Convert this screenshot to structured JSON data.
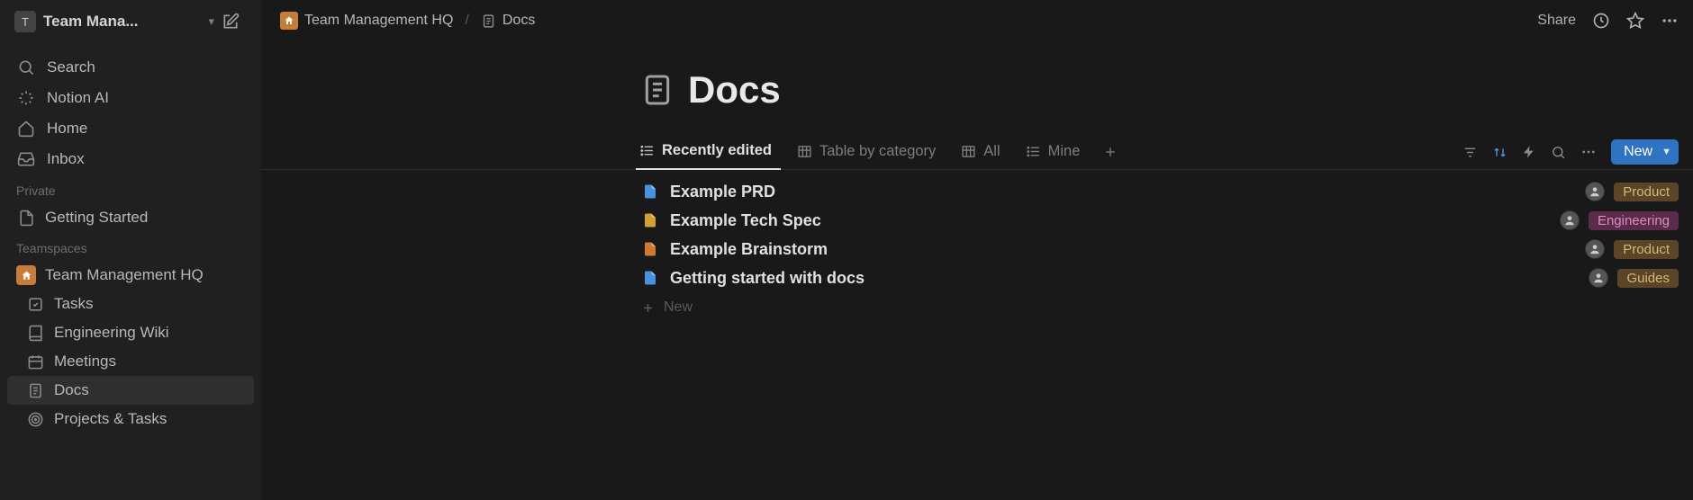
{
  "sidebar": {
    "workspace_letter": "T",
    "workspace_name": "Team Mana...",
    "nav": [
      {
        "icon": "search",
        "label": "Search"
      },
      {
        "icon": "sparkle",
        "label": "Notion AI"
      },
      {
        "icon": "home",
        "label": "Home"
      },
      {
        "icon": "inbox",
        "label": "Inbox"
      }
    ],
    "private_label": "Private",
    "private_pages": [
      {
        "icon": "page",
        "label": "Getting Started"
      }
    ],
    "teamspaces_label": "Teamspaces",
    "teamspace_name": "Team Management HQ",
    "teamspace_pages": [
      {
        "icon": "check",
        "label": "Tasks"
      },
      {
        "icon": "book",
        "label": "Engineering Wiki"
      },
      {
        "icon": "calendar",
        "label": "Meetings"
      },
      {
        "icon": "doc",
        "label": "Docs",
        "active": true
      },
      {
        "icon": "target",
        "label": "Projects & Tasks"
      }
    ]
  },
  "breadcrumb": {
    "workspace": "Team Management HQ",
    "page": "Docs"
  },
  "topbar": {
    "share": "Share"
  },
  "page": {
    "title": "Docs"
  },
  "views": {
    "tabs": [
      {
        "icon": "list",
        "label": "Recently edited",
        "active": true
      },
      {
        "icon": "table",
        "label": "Table by category"
      },
      {
        "icon": "table",
        "label": "All"
      },
      {
        "icon": "list",
        "label": "Mine"
      }
    ],
    "new_label": "New"
  },
  "docs": [
    {
      "icon_color": "#4a8fe0",
      "title": "Example PRD",
      "tag": "Product",
      "tag_class": "tag-product"
    },
    {
      "icon_color": "#d0a030",
      "title": "Example Tech Spec",
      "tag": "Engineering",
      "tag_class": "tag-engineering"
    },
    {
      "icon_color": "#d07a30",
      "title": "Example Brainstorm",
      "tag": "Product",
      "tag_class": "tag-product"
    },
    {
      "icon_color": "#4a8fe0",
      "title": "Getting started with docs",
      "tag": "Guides",
      "tag_class": "tag-guides"
    }
  ],
  "new_row": "New"
}
